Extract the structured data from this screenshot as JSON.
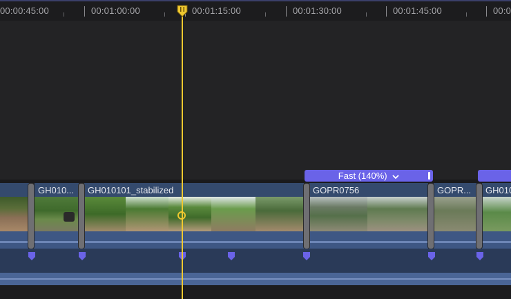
{
  "ruler": {
    "timecodes": [
      "00:00:45:00",
      "00:01:00:00",
      "00:01:15:00",
      "00:01:30:00",
      "00:01:45:00",
      "00:0"
    ]
  },
  "clips": [
    {
      "name": "",
      "icon": "video-clip"
    },
    {
      "name": "GH010..."
    },
    {
      "name": "GH010101_stabilized"
    },
    {
      "name": "GOPR0756"
    },
    {
      "name": "GOPR..."
    },
    {
      "name": "GH010"
    }
  ],
  "retime": {
    "label": "Fast (140%)",
    "chevron": "chevron-down-icon"
  },
  "colors": {
    "playhead": "#f0c92f",
    "clip_header": "#344a6d",
    "audio": "#3e5784",
    "retime_bar": "#6a63e8",
    "marker": "#6a63e8"
  }
}
